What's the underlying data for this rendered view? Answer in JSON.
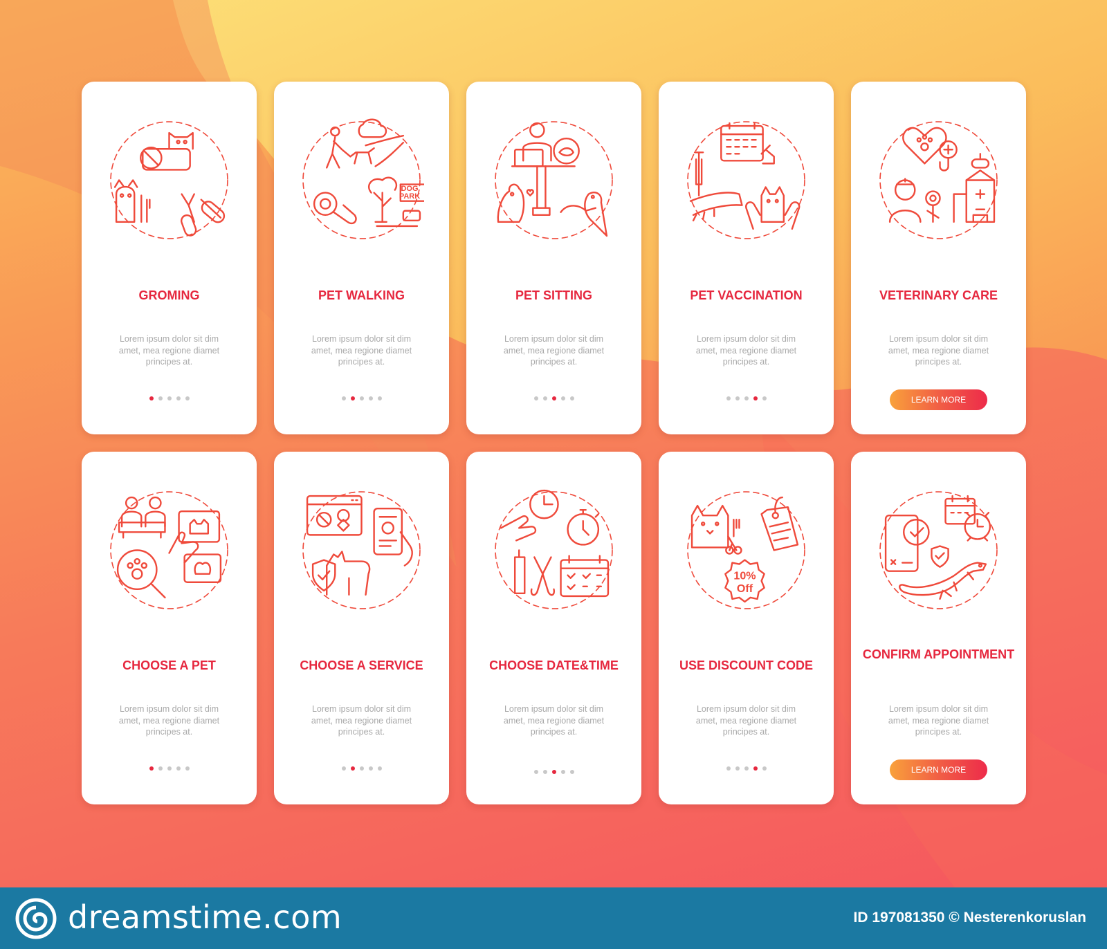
{
  "colors": {
    "accent": "#e6283f",
    "gradient_start": "#f9a13b",
    "gradient_end": "#ed2b4a",
    "footer": "#1b79a2"
  },
  "cards": [
    {
      "title": "GROMING",
      "desc": "Lorem ipsum dolor sit dim amet, mea regione diamet principes at.",
      "active_dot": 1,
      "icon": "grooming-icon"
    },
    {
      "title": "PET WALKING",
      "desc": "Lorem ipsum dolor sit dim amet, mea regione diamet principes at.",
      "active_dot": 2,
      "icon": "pet-walking-icon"
    },
    {
      "title": "PET SITTING",
      "desc": "Lorem ipsum dolor sit dim amet, mea regione diamet principes at.",
      "active_dot": 3,
      "icon": "pet-sitting-icon"
    },
    {
      "title": "PET VACCINATION",
      "desc": "Lorem ipsum dolor sit dim amet, mea regione diamet principes at.",
      "active_dot": 4,
      "icon": "vaccination-icon"
    },
    {
      "title": "VETERINARY CARE",
      "desc": "Lorem ipsum dolor sit dim amet, mea regione diamet principes at.",
      "button": "LEARN MORE",
      "icon": "veterinary-icon"
    },
    {
      "title": "CHOOSE A PET",
      "desc": "Lorem ipsum dolor sit dim amet, mea regione diamet principes at.",
      "active_dot": 1,
      "icon": "choose-pet-icon"
    },
    {
      "title": "CHOOSE A SERVICE",
      "desc": "Lorem ipsum dolor sit dim amet, mea regione diamet principes at.",
      "active_dot": 2,
      "icon": "choose-service-icon"
    },
    {
      "title": "CHOOSE DATE&TIME",
      "desc": "Lorem ipsum dolor sit dim amet, mea regione diamet principes at.",
      "active_dot": 3,
      "icon": "date-time-icon"
    },
    {
      "title": "USE DISCOUNT CODE",
      "desc": "Lorem ipsum dolor sit dim amet, mea regione diamet principes at.",
      "active_dot": 4,
      "icon": "discount-icon"
    },
    {
      "title": "CONFIRM APPOINTMENT",
      "desc": "Lorem ipsum dolor sit dim amet, mea regione diamet principes at.",
      "button": "LEARN MORE",
      "icon": "confirm-appointment-icon"
    }
  ],
  "illustration_text": {
    "dog_park": "DOG PARK",
    "discount": "10% Off"
  },
  "footer": {
    "brand": "dreamstime.com",
    "id_text": "ID 197081350 © Nesterenkoruslan"
  }
}
